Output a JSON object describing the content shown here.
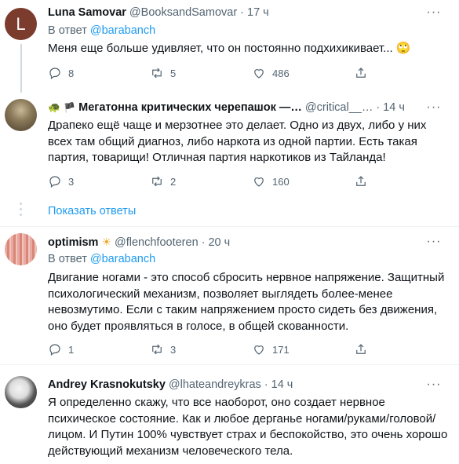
{
  "tweets": [
    {
      "avatar_letter": "L",
      "name": "Luna Samovar",
      "handle": "@BooksandSamovar",
      "time": "17 ч",
      "reply_prefix": "В ответ",
      "reply_to": "@barabanch",
      "text": "Меня еще больше удивляет, что он постоянно подхихикивает...",
      "emoji": "🙄",
      "replies": "8",
      "retweets": "5",
      "likes": "486"
    },
    {
      "name": "Мегатонна критических черепашок —…",
      "handle": "@critical__…",
      "time": "14 ч",
      "text": "Драпеко ещё чаще и мерзотнее это делает. Одно из двух, либо у них всех там общий диагноз, либо наркота из одной партии. Есть такая партия, товарищи! Отличная партия наркотиков из Тайланда!",
      "replies": "3",
      "retweets": "2",
      "likes": "160"
    },
    {
      "name": "optimism",
      "handle": "@flenchfooteren",
      "time": "20 ч",
      "reply_prefix": "В ответ",
      "reply_to": "@barabanch",
      "text": "Двигание ногами - это способ сбросить нервное напряжение. Защитный психологический механизм, позволяет выглядеть более-менее невозмутимо. Если с таким напряжением просто сидеть без движения, оно будет проявляться в голосе, в общей скованности.",
      "replies": "1",
      "retweets": "3",
      "likes": "171"
    },
    {
      "name": "Andrey Krasnokutsky",
      "handle": "@lhateandreykras",
      "time": "14 ч",
      "text": "Я определенно скажу, что все наоборот, оно создает нервное психическое состояние. Как и любое дерганье ногами/руками/головой/лицом. И Путин 100% чувствует страх и беспокойство, это очень хорошо действующий механизм человеческого тела."
    }
  ],
  "show_replies_label": "Показать ответы",
  "separator_dot": "·",
  "more_label": "···",
  "accent_color": "#1d9bf0"
}
